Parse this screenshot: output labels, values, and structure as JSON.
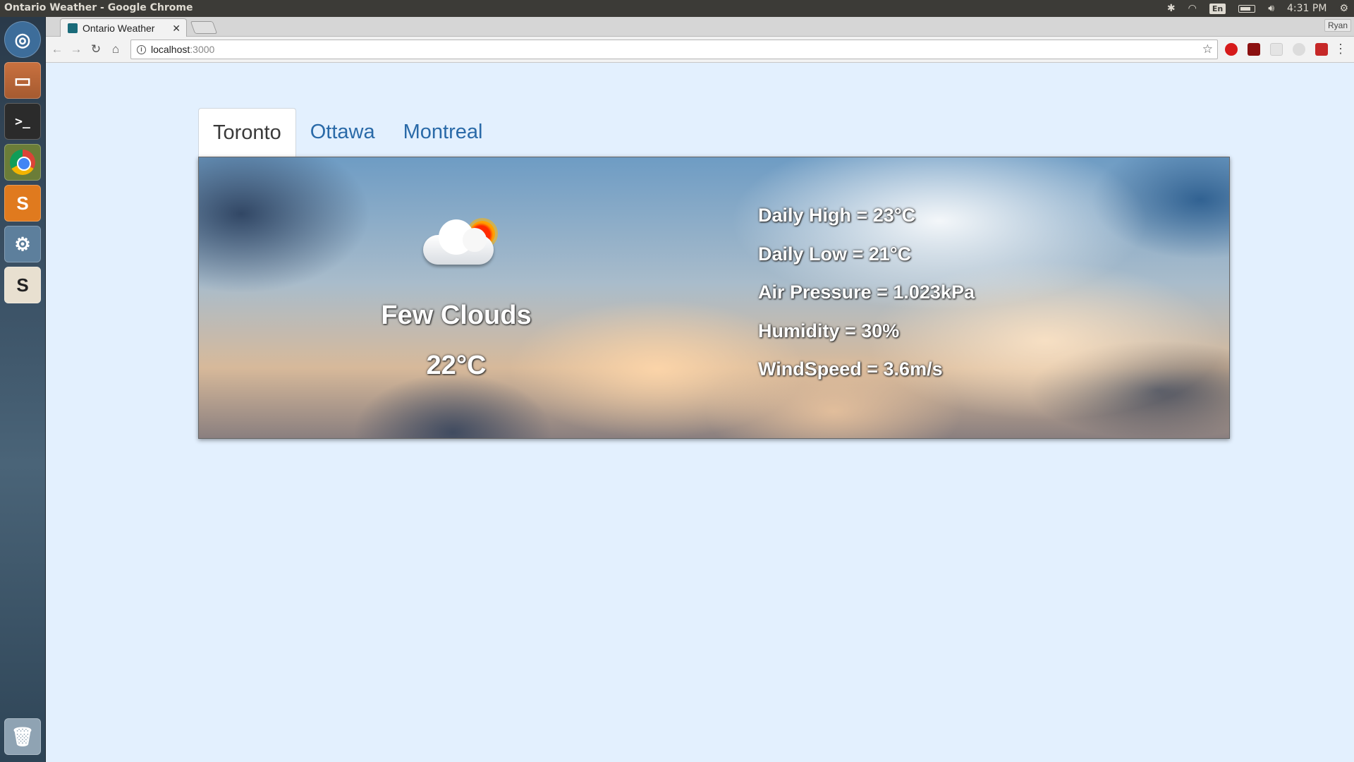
{
  "system": {
    "window_title": "Ontario Weather - Google Chrome",
    "language": "En",
    "clock": "4:31 PM"
  },
  "browser": {
    "tab_title": "Ontario Weather",
    "url_host": "localhost",
    "url_port": ":3000",
    "profile_name": "Ryan"
  },
  "weather_app": {
    "city_tabs": [
      {
        "label": "Toronto",
        "active": true
      },
      {
        "label": "Ottawa",
        "active": false
      },
      {
        "label": "Montreal",
        "active": false
      }
    ],
    "current": {
      "icon": "few-clouds-icon",
      "condition": "Few Clouds",
      "temperature": "22°C"
    },
    "details": [
      "Daily High = 23°C",
      "Daily Low = 21°C",
      "Air Pressure = 1.023kPa",
      "Humidity = 30%",
      "WindSpeed = 3.6m/s"
    ]
  }
}
